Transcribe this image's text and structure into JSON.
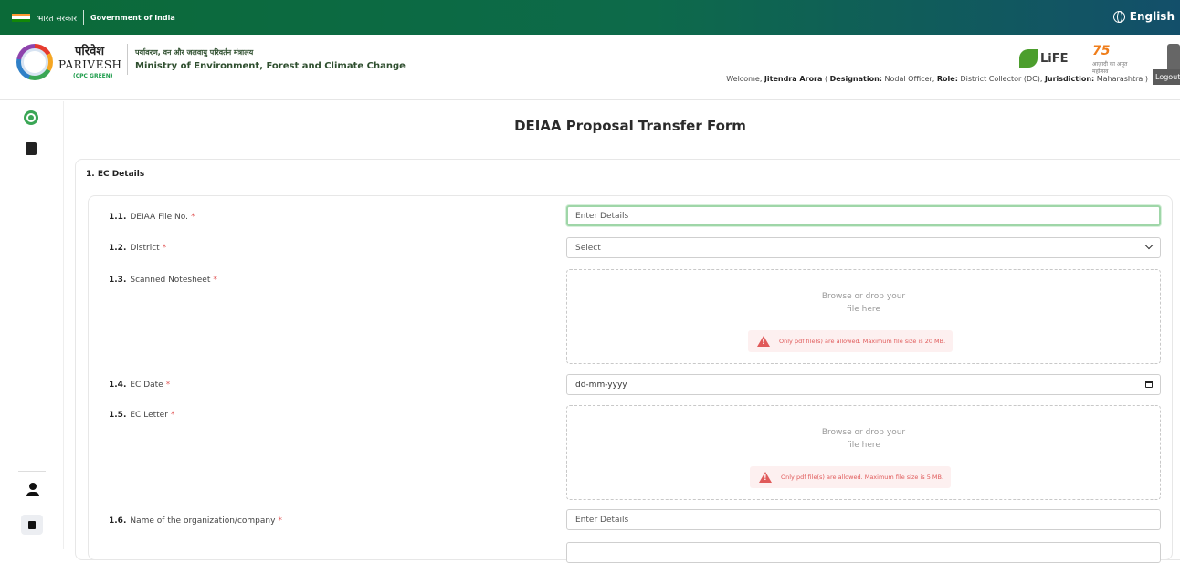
{
  "gov_bar": {
    "hindi_label": "भारत सरकार",
    "english_label": "Government of India",
    "language_button": "English",
    "flag_colors": [
      "#ff9933",
      "#ffffff",
      "#138808"
    ],
    "bar_color": "#0b6a38"
  },
  "header": {
    "brand_hindi": "परिवेश",
    "brand_english": "PARIVESH",
    "brand_sub": "(CPC GREEN)",
    "ministry_hindi": "पर्यावरण, वन और जलवायु परिवर्तन मंत्रालय",
    "ministry_english": "Ministry of Environment, Forest and Climate Change",
    "life_logo": "LiFE",
    "amrit_logo": "75",
    "amrit_sub": "आज़ादी का अमृत महोत्सव",
    "welcome": {
      "prefix": "Welcome,",
      "name": "Jitendra Arora",
      "designation_label": "Designation:",
      "designation": "Nodal Officer,",
      "role_label": "Role:",
      "role": "District Collector (DC),",
      "jurisdiction_label": "Jurisdiction:",
      "jurisdiction": "Maharashtra",
      "paren_open": "(",
      "paren_close": ")"
    },
    "logout_label": "Logout"
  },
  "sidebar": {
    "items": [
      {
        "icon": "dashboard-icon"
      },
      {
        "icon": "clipboard-icon"
      },
      {
        "icon": "user-icon"
      },
      {
        "icon": "logout-icon"
      }
    ]
  },
  "form": {
    "title": "DEIAA Proposal Transfer Form",
    "section_title": "1. EC Details",
    "required_mark": "*",
    "fields": [
      {
        "num": "1.1.",
        "label": "DEIAA File No.",
        "type": "text",
        "placeholder": "Enter Details"
      },
      {
        "num": "1.2.",
        "label": "District",
        "type": "select",
        "value": "Select"
      },
      {
        "num": "1.3.",
        "label": "Scanned Notesheet",
        "type": "file",
        "drop_line1": "Browse or drop your",
        "drop_line2": "file here",
        "warning": "Only pdf file(s) are allowed. Maximum file size is 20 MB."
      },
      {
        "num": "1.4.",
        "label": "EC Date",
        "type": "date",
        "placeholder": "dd-mm-yyyy"
      },
      {
        "num": "1.5.",
        "label": "EC Letter",
        "type": "file",
        "drop_line1": "Browse or drop your",
        "drop_line2": "file here",
        "warning": "Only pdf file(s) are allowed. Maximum file size is 5 MB."
      },
      {
        "num": "1.6.",
        "label": "Name of the organization/company",
        "type": "text",
        "placeholder": "Enter Details"
      }
    ]
  }
}
